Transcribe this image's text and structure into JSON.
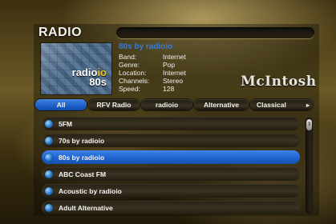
{
  "header": {
    "title": "RADIO"
  },
  "album_art": {
    "name_main": "radio",
    "name_accent": "io",
    "name_sub": "80s"
  },
  "now_playing": {
    "station": "80s by radioio",
    "details": [
      {
        "key": "Band:",
        "value": "Internet"
      },
      {
        "key": "Genre:",
        "value": "Pop"
      },
      {
        "key": "Location:",
        "value": "Internet"
      },
      {
        "key": "Channels:",
        "value": "Stereo"
      },
      {
        "key": "Speed:",
        "value": "128"
      }
    ]
  },
  "brand": {
    "logo": "McIntosh"
  },
  "tabs": [
    {
      "label": "All",
      "active": true
    },
    {
      "label": "RFV Radio",
      "active": false
    },
    {
      "label": "radioio",
      "active": false
    },
    {
      "label": "Alternative",
      "active": false
    },
    {
      "label": "Classical",
      "active": false
    }
  ],
  "tab_more_icon": "chevron-right-icon",
  "stations": [
    {
      "label": "5FM",
      "selected": false
    },
    {
      "label": "70s by radioio",
      "selected": false
    },
    {
      "label": "80s by radioio",
      "selected": true
    },
    {
      "label": "ABC Coast FM",
      "selected": false
    },
    {
      "label": "Acoustic by radioio",
      "selected": false
    },
    {
      "label": "Adult Alternative",
      "selected": false
    }
  ],
  "colors": {
    "accent": "#2a6fd8",
    "station_title": "#3a7bd5",
    "brand_gold": "#f0c419"
  }
}
